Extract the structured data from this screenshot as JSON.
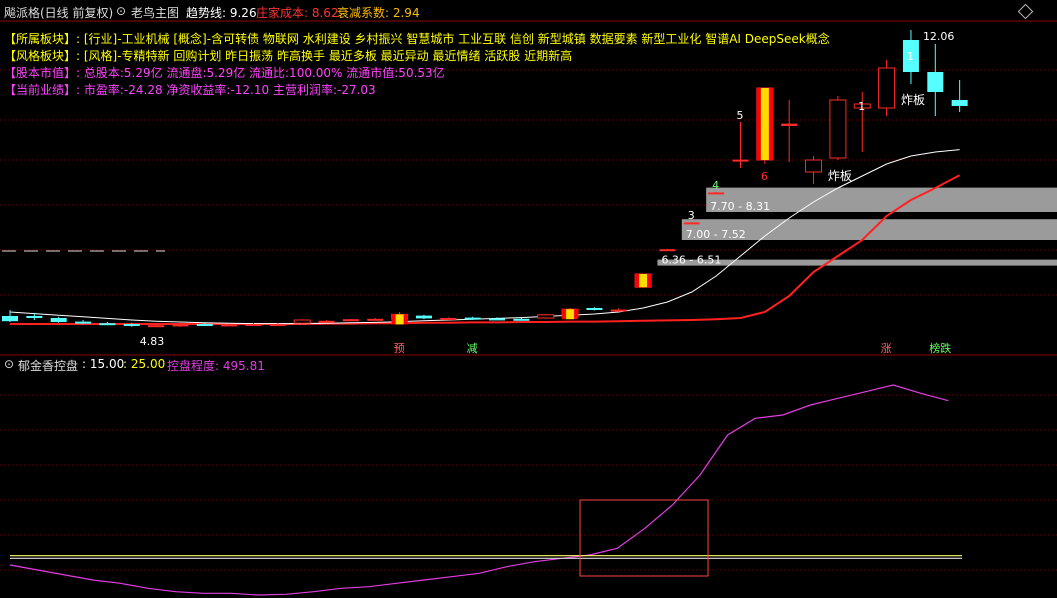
{
  "header": {
    "title": "飚派格(日线 前复权)",
    "indicator_name": "老鸟主图",
    "trend_label": "趋势线: 9.26",
    "cost_label": "庄家成本: 8.62",
    "decay_label": "衰减系数: 2.94"
  },
  "info": [
    {
      "label": "【所属板块】:",
      "text": "[行业]-工业机械 [概念]-含可转债 物联网 水利建设 乡村振兴 智慧城市 工业互联 信创 新型城镇 数据要素 新型工业化 智谱AI DeepSeek概念",
      "label_color": "#ffff00",
      "text_color": "#ffff00"
    },
    {
      "label": "【风格板块】:",
      "text": "[风格]-专精特新 回购计划 昨日振荡 昨高换手 最近多板 最近异动 最近情绪 活跃股 近期新高",
      "label_color": "#ffff00",
      "text_color": "#ffff00"
    },
    {
      "label": "【股本市值】:",
      "text": "总股本:5.29亿 流通盘:5.29亿 流通比:100.00% 流通市值:50.53亿",
      "label_color": "#ff44ff",
      "text_color": "#ff44ff"
    },
    {
      "label": "【当前业绩】:",
      "text": "市盈率:-24.28 净资收益率:-12.10 主营利润率:-27.03",
      "label_color": "#ff44ff",
      "text_color": "#ff44ff"
    }
  ],
  "sub": {
    "name": "郁金香控盘",
    "p1": ": 15.00",
    "p2": ": 25.00",
    "control_label": "控盘程度: 495.81"
  },
  "colors": {
    "up": "#ff2a2a",
    "down": "#55ffff",
    "trend": "#ffffff",
    "cost": "#ff2020",
    "purple": "#e23ee2",
    "yellow": "#ffff00",
    "zone": "#9b9b9b"
  },
  "chart_data": [
    {
      "type": "candlestick",
      "title": "老鸟主图",
      "ylim": [
        4.5,
        12.5
      ],
      "candles": [
        {
          "o": 5.1,
          "h": 5.25,
          "l": 4.95,
          "c": 4.97
        },
        {
          "o": 5.1,
          "h": 5.18,
          "l": 5.0,
          "c": 5.05
        },
        {
          "o": 5.05,
          "h": 5.08,
          "l": 4.93,
          "c": 4.95
        },
        {
          "o": 4.96,
          "h": 5.0,
          "l": 4.9,
          "c": 4.93
        },
        {
          "o": 4.92,
          "h": 4.95,
          "l": 4.87,
          "c": 4.9
        },
        {
          "o": 4.9,
          "h": 4.93,
          "l": 4.83,
          "c": 4.86
        },
        {
          "o": 4.86,
          "h": 4.9,
          "l": 4.83,
          "c": 4.87
        },
        {
          "o": 4.84,
          "h": 4.92,
          "l": 4.83,
          "c": 4.9
        },
        {
          "o": 4.9,
          "h": 4.92,
          "l": 4.86,
          "c": 4.88
        },
        {
          "o": 4.88,
          "h": 4.91,
          "l": 4.86,
          "c": 4.89
        },
        {
          "o": 4.89,
          "h": 4.92,
          "l": 4.87,
          "c": 4.9
        },
        {
          "o": 4.88,
          "h": 4.92,
          "l": 4.86,
          "c": 4.9
        },
        {
          "o": 4.92,
          "h": 5.02,
          "l": 4.9,
          "c": 5.0
        },
        {
          "o": 4.97,
          "h": 5.0,
          "l": 4.95,
          "c": 4.98
        },
        {
          "o": 4.99,
          "h": 5.03,
          "l": 4.97,
          "c": 5.02
        },
        {
          "o": 5.02,
          "h": 5.05,
          "l": 5.0,
          "c": 5.03
        },
        {
          "o": 5.02,
          "h": 5.2,
          "l": 4.99,
          "c": 5.14
        },
        {
          "o": 5.11,
          "h": 5.13,
          "l": 5.02,
          "c": 5.04
        },
        {
          "o": 5.03,
          "h": 5.07,
          "l": 5.0,
          "c": 5.05
        },
        {
          "o": 5.06,
          "h": 5.08,
          "l": 5.01,
          "c": 5.03
        },
        {
          "o": 5.04,
          "h": 5.07,
          "l": 5.0,
          "c": 5.02
        },
        {
          "o": 5.03,
          "h": 5.05,
          "l": 5.0,
          "c": 5.01
        },
        {
          "o": 5.05,
          "h": 5.15,
          "l": 5.03,
          "c": 5.13
        },
        {
          "o": 5.08,
          "h": 5.3,
          "l": 5.07,
          "c": 5.27
        },
        {
          "o": 5.3,
          "h": 5.32,
          "l": 5.24,
          "c": 5.25
        },
        {
          "o": 5.25,
          "h": 5.3,
          "l": 5.2,
          "c": 5.26
        },
        {
          "o": 5.82,
          "h": 6.15,
          "l": 5.8,
          "c": 6.15
        },
        {
          "o": 6.77,
          "h": 6.78,
          "l": 6.76,
          "c": 6.77
        },
        {
          "o": 7.44,
          "h": 7.45,
          "l": 7.43,
          "c": 7.44
        },
        {
          "o": 8.19,
          "h": 8.2,
          "l": 8.18,
          "c": 8.19
        },
        {
          "o": 9.01,
          "h": 9.95,
          "l": 8.8,
          "c": 9.01
        },
        {
          "o": 9.0,
          "h": 10.8,
          "l": 8.9,
          "c": 10.8
        },
        {
          "o": 9.85,
          "h": 10.5,
          "l": 8.95,
          "c": 9.91
        },
        {
          "o": 8.7,
          "h": 9.1,
          "l": 8.4,
          "c": 9.0
        },
        {
          "o": 9.05,
          "h": 10.6,
          "l": 9.0,
          "c": 10.5
        },
        {
          "o": 10.3,
          "h": 10.7,
          "l": 9.2,
          "c": 10.4
        },
        {
          "o": 10.3,
          "h": 11.5,
          "l": 10.1,
          "c": 11.3
        },
        {
          "o": 12.0,
          "h": 12.25,
          "l": 10.9,
          "c": 11.2
        },
        {
          "o": 11.2,
          "h": 11.9,
          "l": 10.1,
          "c": 10.7
        },
        {
          "o": 10.5,
          "h": 11.0,
          "l": 10.2,
          "c": 10.35
        }
      ],
      "trend_line": [
        5.2,
        5.16,
        5.12,
        5.08,
        5.04,
        5.0,
        4.97,
        4.95,
        4.93,
        4.92,
        4.91,
        4.91,
        4.91,
        4.92,
        4.93,
        4.94,
        4.96,
        4.98,
        5.0,
        5.02,
        5.04,
        5.06,
        5.09,
        5.12,
        5.15,
        5.2,
        5.3,
        5.45,
        5.7,
        6.1,
        6.6,
        7.1,
        7.55,
        7.95,
        8.3,
        8.6,
        8.9,
        9.1,
        9.2,
        9.26
      ],
      "cost_line": [
        4.9,
        4.9,
        4.9,
        4.9,
        4.9,
        4.9,
        4.9,
        4.9,
        4.9,
        4.9,
        4.9,
        4.9,
        4.9,
        4.91,
        4.91,
        4.92,
        4.92,
        4.93,
        4.93,
        4.94,
        4.94,
        4.95,
        4.95,
        4.96,
        4.96,
        4.97,
        4.98,
        4.99,
        5.0,
        5.02,
        5.05,
        5.2,
        5.6,
        6.2,
        6.6,
        7.0,
        7.6,
        8.0,
        8.3,
        8.62
      ],
      "zones": [
        {
          "low": 7.7,
          "high": 8.31,
          "label": "7.70 - 8.31",
          "from": 29
        },
        {
          "low": 7.0,
          "high": 7.52,
          "label": "7.00 - 7.52",
          "from": 28
        },
        {
          "low": 6.36,
          "high": 6.51,
          "label": "6.36 - 6.51",
          "from": 27
        }
      ],
      "annotations": [
        {
          "i": 37,
          "text": "12.06",
          "kind": "high"
        },
        {
          "i": 5,
          "text": "4.83",
          "kind": "low"
        },
        {
          "i": 30,
          "text": "5",
          "kind": "count"
        },
        {
          "i": 29,
          "text": "4",
          "kind": "count"
        },
        {
          "i": 28,
          "text": "3",
          "kind": "count"
        },
        {
          "i": 31,
          "text": "6",
          "kind": "count"
        },
        {
          "i": 35,
          "text": "1",
          "kind": "count"
        },
        {
          "i": 37,
          "text": "1",
          "kind": "count"
        },
        {
          "i": 34,
          "text": "炸板",
          "kind": "note"
        },
        {
          "i": 37,
          "text": "炸板",
          "kind": "note"
        }
      ],
      "signals": [
        {
          "i": 16,
          "text": "预",
          "color": "#ff6666"
        },
        {
          "i": 19,
          "text": "减",
          "color": "#66ff66"
        },
        {
          "i": 36,
          "text": "涨",
          "color": "#ff6666"
        },
        {
          "i": 38,
          "text": "榜跌",
          "color": "#66ff66"
        }
      ]
    },
    {
      "type": "line",
      "title": "郁金香控盘",
      "ylim": [
        0,
        600
      ],
      "series": [
        {
          "name": "控盘程度",
          "values": [
            60,
            45,
            30,
            15,
            5,
            -10,
            -20,
            -25,
            -25,
            -30,
            -28,
            -20,
            -10,
            -5,
            5,
            15,
            25,
            35,
            55,
            70,
            80,
            90,
            110,
            170,
            240,
            330,
            450,
            500,
            510,
            540,
            560,
            580,
            600,
            575,
            553
          ],
          "color": "#e23ee2"
        },
        {
          "name": "",
          "values": [
            88,
            88,
            88,
            88,
            88,
            88,
            88,
            88,
            88,
            88,
            88,
            88,
            88,
            88,
            88,
            88,
            88,
            88,
            88,
            88,
            88,
            88,
            88,
            88,
            88,
            88,
            88,
            88,
            88,
            88,
            88,
            88,
            88,
            88,
            88
          ],
          "color": "#ffff66"
        },
        {
          "name": "",
          "values": [
            80,
            80,
            80,
            80,
            80,
            80,
            80,
            80,
            80,
            80,
            80,
            80,
            80,
            80,
            80,
            80,
            80,
            80,
            80,
            80,
            80,
            80,
            80,
            80,
            80,
            80,
            80,
            80,
            80,
            80,
            80,
            80,
            80,
            80,
            80
          ],
          "color": "#dddddd"
        }
      ]
    }
  ]
}
